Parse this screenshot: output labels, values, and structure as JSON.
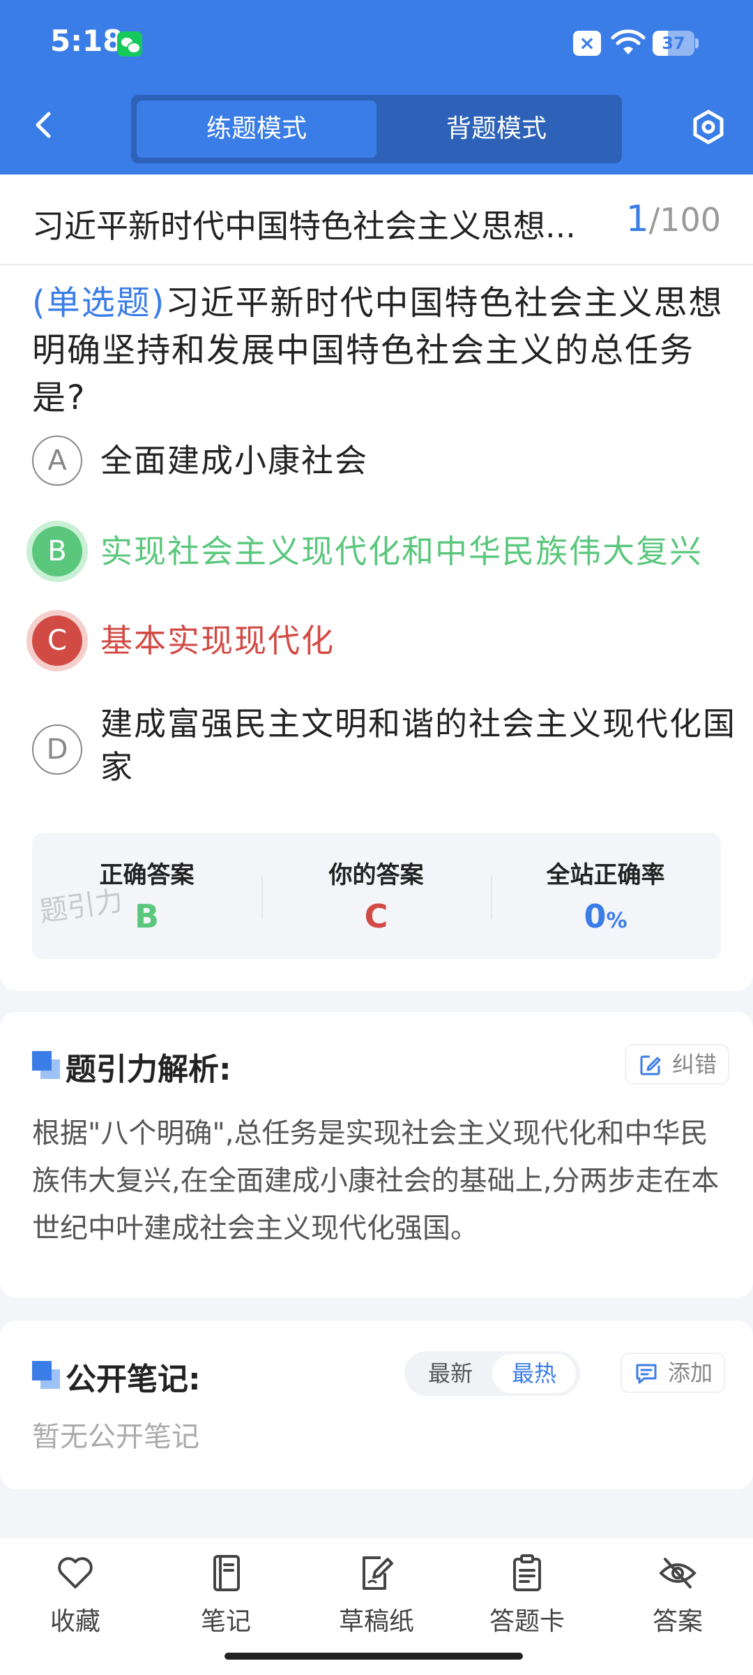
{
  "status_bar": {
    "time": "5:18",
    "battery_level": "37",
    "battery_fraction": 0.37,
    "icons": [
      "wechat-icon",
      "no-sim-icon",
      "wifi-icon",
      "battery-icon"
    ]
  },
  "header": {
    "mode_practice": "练题模式",
    "mode_memorize": "背题模式",
    "active_mode": "练题模式",
    "accent_color": "#3b7de6"
  },
  "question": {
    "title": "习近平新时代中国特色社会主义思想...",
    "current": "1",
    "total": "/100",
    "type_label": "(单选题)",
    "text": "习近平新时代中国特色社会主义思想明确坚持和发展中国特色社会主义的总任务是?",
    "options": [
      {
        "letter": "A",
        "text": "全面建成小康社会",
        "state": "normal"
      },
      {
        "letter": "B",
        "text": "实现社会主义现代化和中华民族伟大复兴",
        "state": "correct"
      },
      {
        "letter": "C",
        "text": "基本实现现代化",
        "state": "wrong"
      },
      {
        "letter": "D",
        "text": "建成富强民主文明和谐的社会主义现代化国家",
        "state": "normal"
      }
    ]
  },
  "answer_summary": {
    "correct_label": "正确答案",
    "correct_value": "B",
    "yours_label": "你的答案",
    "yours_value": "C",
    "rate_label": "全站正确率",
    "rate_value": "0",
    "rate_unit": "%",
    "watermark": "题引力",
    "correct_color": "#5ac77d",
    "wrong_color": "#d24a44"
  },
  "analysis": {
    "title": "题引力解析:",
    "report_label": "纠错",
    "text": "根据\"八个明确\",总任务是实现社会主义现代化和中华民族伟大复兴,在全面建成小康社会的基础上,分两步走在本世纪中叶建成社会主义现代化强国。"
  },
  "notes": {
    "title": "公开笔记:",
    "sort_newest": "最新",
    "sort_hottest": "最热",
    "active_sort": "最热",
    "add_label": "添加",
    "empty_text": "暂无公开笔记"
  },
  "bottom_tabs": [
    {
      "label": "收藏",
      "icon": "heart-icon"
    },
    {
      "label": "笔记",
      "icon": "notebook-icon"
    },
    {
      "label": "草稿纸",
      "icon": "draft-paper-icon"
    },
    {
      "label": "答题卡",
      "icon": "answer-sheet-icon"
    },
    {
      "label": "答案",
      "icon": "eye-off-icon"
    }
  ]
}
